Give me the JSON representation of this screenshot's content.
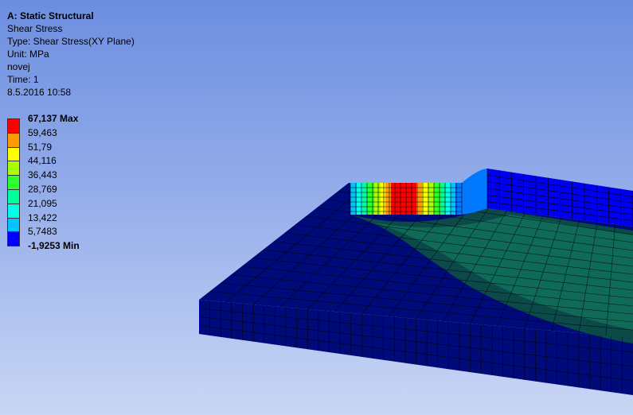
{
  "header": {
    "title": "A: Static Structural",
    "result_name": "Shear Stress",
    "type": "Type: Shear Stress(XY Plane)",
    "unit": "Unit: MPa",
    "user": "novej",
    "time": "Time: 1",
    "date": "8.5.2016 10:58"
  },
  "legend": {
    "levels": [
      {
        "label": "67,137 Max",
        "color": "#ff0000",
        "bold": true
      },
      {
        "label": "59,463",
        "color": "#ff9a00",
        "bold": false
      },
      {
        "label": "51,79",
        "color": "#ffff00",
        "bold": false
      },
      {
        "label": "44,116",
        "color": "#a8ff00",
        "bold": false
      },
      {
        "label": "36,443",
        "color": "#2eff2e",
        "bold": false
      },
      {
        "label": "28,769",
        "color": "#00ff9c",
        "bold": false
      },
      {
        "label": "21,095",
        "color": "#00ffe8",
        "bold": false
      },
      {
        "label": "13,422",
        "color": "#00c3ff",
        "bold": false
      },
      {
        "label": "5,7483",
        "color": "#0078ff",
        "bold": false
      },
      {
        "label": "-1,9253 Min",
        "color": "#0000ff",
        "bold": true
      }
    ]
  },
  "model": {
    "base_color": "#000a78",
    "wall_color": "#0000ee",
    "contact_color": "#0f6b58",
    "contact_dark_color": "#0c4a4a",
    "mesh_line_color": "#000000"
  }
}
